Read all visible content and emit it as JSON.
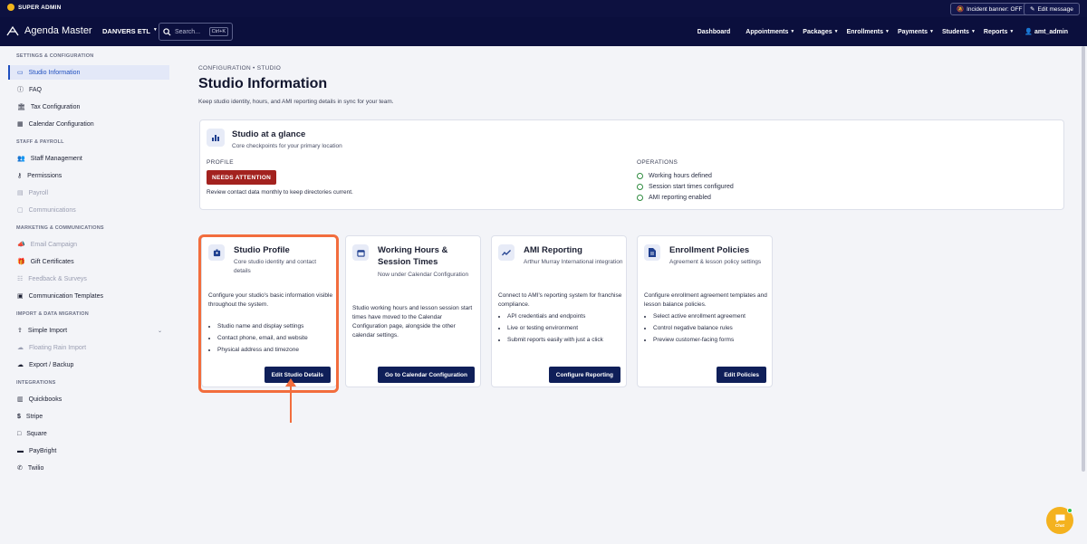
{
  "adminbar": {
    "label": "SUPER ADMIN",
    "incident": "Incident banner: OFF",
    "edit_message": "Edit message"
  },
  "nav": {
    "brand": "Agenda Master",
    "studio": "DANVERS ETL",
    "search_placeholder": "Search...",
    "search_kbd": "Ctrl+K",
    "links": [
      "Dashboard",
      "Appointments",
      "Packages",
      "Enrollments",
      "Payments",
      "Students",
      "Reports"
    ],
    "user": "amt_admin"
  },
  "sidebar": {
    "sections": [
      "SETTINGS & CONFIGURATION",
      "STAFF & PAYROLL",
      "MARKETING & COMMUNICATIONS",
      "IMPORT & DATA MIGRATION",
      "INTEGRATIONS"
    ],
    "items": [
      "Studio Information",
      "FAQ",
      "Tax Configuration",
      "Calendar Configuration",
      "Staff Management",
      "Permissions",
      "Payroll",
      "Communications",
      "Email Campaign",
      "Gift Certificates",
      "Feedback & Surveys",
      "Communication Templates",
      "Simple Import",
      "Floating Rain Import",
      "Export / Backup",
      "Quickbooks",
      "Stripe",
      "Square",
      "PayBright",
      "Twilio"
    ]
  },
  "page": {
    "breadcrumb": "CONFIGURATION • STUDIO",
    "title": "Studio Information",
    "subtitle": "Keep studio identity, hours, and AMI reporting details in sync for your team."
  },
  "glance": {
    "title": "Studio at a glance",
    "subtitle": "Core checkpoints for your primary location",
    "profile_label": "PROFILE",
    "badge": "NEEDS ATTENTION",
    "note": "Review contact data monthly to keep directories current.",
    "operations_label": "OPERATIONS",
    "checks": [
      "Working hours defined",
      "Session start times configured",
      "AMI reporting enabled"
    ]
  },
  "cards": [
    {
      "title": "Studio Profile",
      "subtitle": "Core studio identity and contact details",
      "desc": "Configure your studio's basic information visible throughout the system.",
      "bullets": [
        "Studio name and display settings",
        "Contact phone, email, and website",
        "Physical address and timezone"
      ],
      "button": "Edit Studio Details"
    },
    {
      "title": "Working Hours & Session Times",
      "subtitle": "Now under Calendar Configuration",
      "desc": "Studio working hours and lesson session start times have moved to the Calendar Configuration page, alongside the other calendar settings.",
      "bullets": [],
      "button": "Go to Calendar Configuration"
    },
    {
      "title": "AMI Reporting",
      "subtitle": "Arthur Murray International integration",
      "desc": "Connect to AMI's reporting system for franchise compliance.",
      "bullets": [
        "API credentials and endpoints",
        "Live or testing environment",
        "Submit reports easily with just a click"
      ],
      "button": "Configure Reporting"
    },
    {
      "title": "Enrollment Policies",
      "subtitle": "Agreement & lesson policy settings",
      "desc": "Configure enrollment agreement templates and lesson balance policies.",
      "bullets": [
        "Select active enrollment agreement",
        "Control negative balance rules",
        "Preview customer-facing forms"
      ],
      "button": "Edit Policies"
    }
  ],
  "chat": {
    "label": "Chat"
  },
  "colors": {
    "nav": "#0b0f3d",
    "accent": "#1f4fbf",
    "badge": "#a3221f",
    "highlight": "#f26d3d",
    "button": "#0f1f59"
  }
}
